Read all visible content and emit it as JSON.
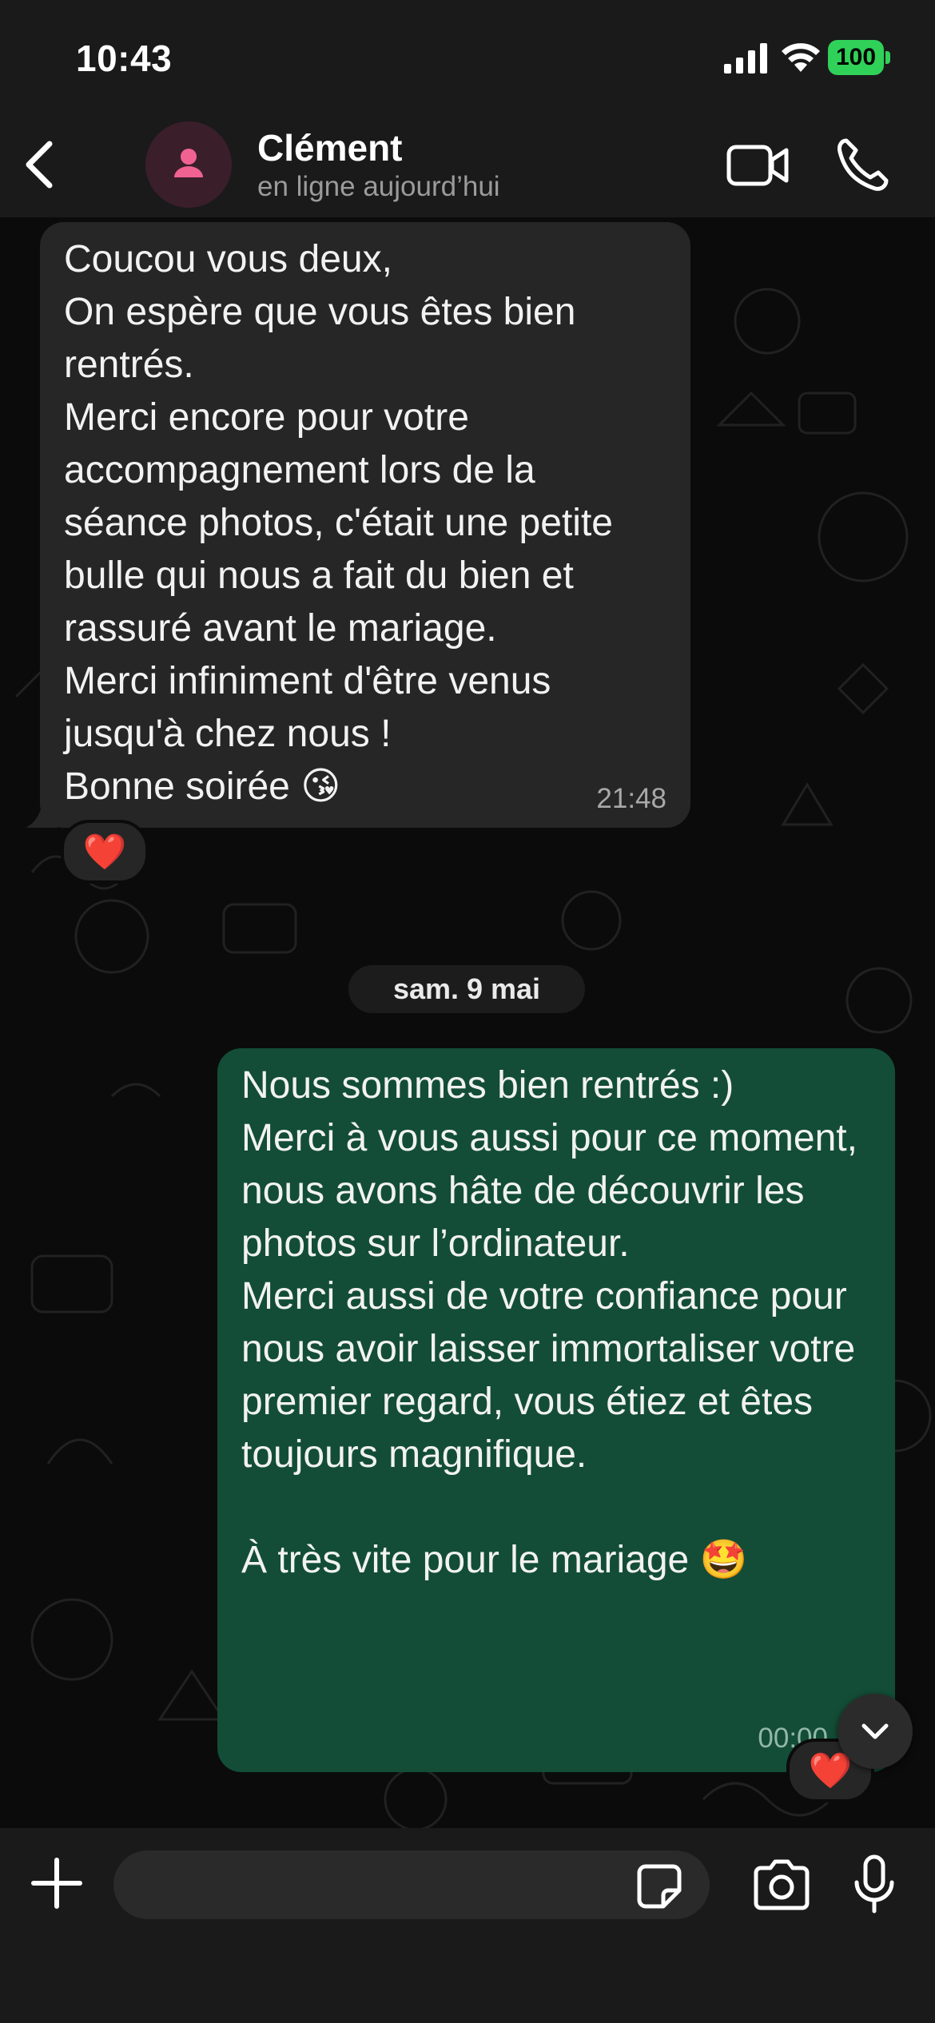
{
  "status_bar": {
    "time": "10:43",
    "battery": "100",
    "battery_color": "#30d158"
  },
  "header": {
    "contact_name": "Clément",
    "contact_status": "en ligne aujourd’hui",
    "icons": [
      "back-chevron",
      "person-avatar",
      "video-camera",
      "phone"
    ],
    "avatar_bg": "#3a1f2b",
    "avatar_icon_color": "#f06292"
  },
  "messages": [
    {
      "direction": "incoming",
      "text": "Coucou vous deux,\nOn espère que vous êtes bien rentrés.\nMerci encore pour votre accompagnement lors de la séance photos, c'était une petite bulle qui nous a fait du bien et rassuré avant le mariage.\nMerci infiniment d'être venus jusqu'à chez nous !\nBonne soirée 😘",
      "time": "21:48",
      "reaction": "❤️",
      "bubble_color": "#262626"
    },
    {
      "direction": "outgoing",
      "text": "Nous sommes bien rentrés :)\nMerci à vous aussi pour ce moment, nous avons hâte de découvrir les photos sur l’ordinateur.\nMerci aussi de votre confiance pour nous avoir laisser immortaliser votre premier regard, vous étiez et êtes toujours magnifique.\n\nÀ très vite pour le mariage 🤩",
      "time": "00:00",
      "reaction": "❤️",
      "bubble_color": "#134d37"
    }
  ],
  "date_separator": "sam. 9 mai",
  "input": {
    "placeholder": "",
    "value": "",
    "icons": [
      "plus",
      "sticker",
      "camera",
      "microphone"
    ]
  },
  "scroll_button_icon": "chevron-down"
}
